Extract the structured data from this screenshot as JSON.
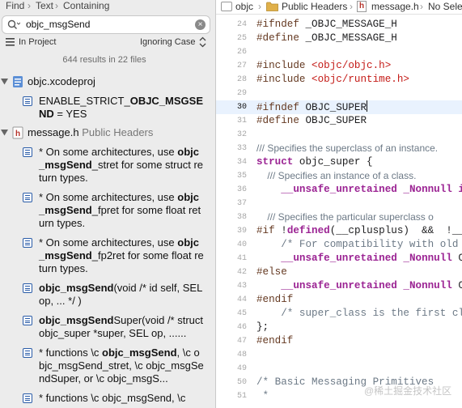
{
  "navigator": {
    "breadcrumb": [
      "Find",
      "Text",
      "Containing"
    ],
    "search": {
      "query": "objc_msgSend",
      "clear_icon": "clear-icon"
    },
    "scope": {
      "project_label": "In Project",
      "case_label": "Ignoring Case"
    },
    "summary": "644 results in 22 files",
    "groups": [
      {
        "name": "objc.xcodeproj",
        "icon": "xcodeproj-icon",
        "items": [
          {
            "lines": [
              {
                "t": "ENABLE_STRICT_",
                "b": false
              },
              {
                "t": "OBJC_MSGSE",
                "b": true
              }
            ],
            "lines2": [
              {
                "t": "ND",
                "b": true
              },
              {
                "t": " = YES",
                "b": false
              }
            ]
          }
        ]
      },
      {
        "name": "message.h",
        "subtitle": "Public Headers",
        "icon": "header-file-icon"
      }
    ],
    "results": [
      [
        "* On some architectures, use ",
        "obj",
        "",
        "c_msgSend",
        "_stret for some struct return types."
      ],
      [
        "* On some architectures, use ",
        "obj",
        "",
        "c_msgSend",
        "_fpret for some float return types."
      ],
      [
        "* On some architectures, use ",
        "obj",
        "",
        "c_msgSend",
        "_fp2ret for some float return types."
      ],
      [
        "",
        "objc_msgSend",
        "(void /* id self, SEL op, ... */ )",
        "",
        ""
      ],
      [
        "",
        "objc_msgSend",
        "Super(void /* struct objc_super *super, SEL op, ......",
        "",
        ""
      ],
      [
        "*  functions \\c ",
        "objc_msgSend",
        ", \\c objc_msgSend_stret, \\c objc_msgSendSuper, or \\c objc_msgS...",
        "",
        ""
      ],
      [
        "*  functions \\c objc_msgSend, \\c",
        "",
        "",
        "",
        ""
      ]
    ]
  },
  "editor": {
    "jump_bar": [
      "objc",
      "Public Headers",
      "message.h",
      "No Selec"
    ],
    "lines": [
      {
        "n": "24",
        "code": "#ifndef _OBJC_MESSAGE_H"
      },
      {
        "n": "25",
        "code": "#define _OBJC_MESSAGE_H"
      },
      {
        "n": "26",
        "code": ""
      },
      {
        "n": "27",
        "code": "#include <objc/objc.h>"
      },
      {
        "n": "28",
        "code": "#include <objc/runtime.h>"
      },
      {
        "n": "29",
        "code": ""
      },
      {
        "n": "30",
        "code": "#ifndef OBJC_SUPER"
      },
      {
        "n": "31",
        "code": "#define OBJC_SUPER"
      },
      {
        "n": "32",
        "code": ""
      },
      {
        "n": "33",
        "code": "/// Specifies the superclass of an instance."
      },
      {
        "n": "34",
        "code": "struct objc_super {"
      },
      {
        "n": "35",
        "code": "    /// Specifies an instance of a class."
      },
      {
        "n": "36",
        "code": "    __unsafe_unretained _Nonnull id"
      },
      {
        "n": "37",
        "code": ""
      },
      {
        "n": "38",
        "code": "    /// Specifies the particular superclass o"
      },
      {
        "n": "39",
        "code": "#if !defined(__cplusplus)  &&  !__"
      },
      {
        "n": "40",
        "code": "    /* For compatibility with old o"
      },
      {
        "n": "41",
        "code": "    __unsafe_unretained _Nonnull Cl"
      },
      {
        "n": "42",
        "code": "#else"
      },
      {
        "n": "43",
        "code": "    __unsafe_unretained _Nonnull Cl"
      },
      {
        "n": "44",
        "code": "#endif"
      },
      {
        "n": "45",
        "code": "    /* super_class is the first cla"
      },
      {
        "n": "46",
        "code": "};"
      },
      {
        "n": "47",
        "code": "#endif"
      },
      {
        "n": "48",
        "code": ""
      },
      {
        "n": "49",
        "code": ""
      },
      {
        "n": "50",
        "code": "/* Basic Messaging Primitives"
      },
      {
        "n": "51",
        "code": " *"
      }
    ],
    "current_line": "30"
  },
  "watermark": "@稀土掘金技术社区",
  "colors": {
    "preprocessor": "#643820",
    "string": "#c41a16",
    "keyword": "#9b2393",
    "type": "#703daa",
    "comment": "#6c7986",
    "current_line_bg": "#e9f2fe",
    "header_icon": "#b5332b",
    "result_icon": "#2d5ea8"
  }
}
